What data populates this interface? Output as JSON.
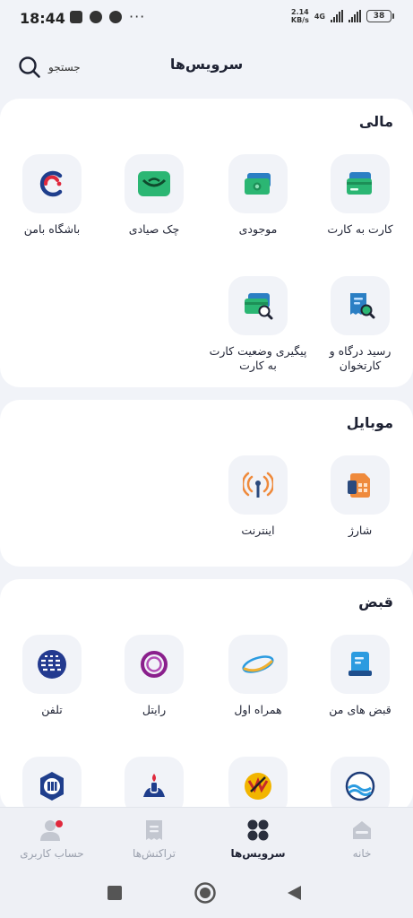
{
  "status_bar": {
    "time": "18:44",
    "speed_value": "2.14",
    "speed_unit": "KB/s",
    "network": "4G",
    "battery": "38"
  },
  "header": {
    "title": "سرویس‌ها",
    "search_label": "جستجو"
  },
  "sections": {
    "finance": {
      "title": "مالی",
      "items": [
        {
          "label": "کارت به کارت",
          "icon": "card-icon"
        },
        {
          "label": "موجودی",
          "icon": "balance-icon"
        },
        {
          "label": "چک صیادی",
          "icon": "cheque-icon"
        },
        {
          "label": "باشگاه بامن",
          "icon": "club-icon"
        },
        {
          "label": "رسید درگاه و کارتخوان",
          "icon": "receipt-search-icon"
        },
        {
          "label": "پیگیری وضعیت کارت به کارت",
          "icon": "card-track-icon"
        }
      ]
    },
    "mobile": {
      "title": "موبایل",
      "items": [
        {
          "label": "شارژ",
          "icon": "sim-card-icon"
        },
        {
          "label": "اینترنت",
          "icon": "antenna-icon"
        }
      ]
    },
    "bills": {
      "title": "قبض",
      "items": [
        {
          "label": "قبض های من",
          "icon": "bill-icon"
        },
        {
          "label": "همراه اول",
          "icon": "hamrah-aval-logo"
        },
        {
          "label": "رایتل",
          "icon": "rightel-logo"
        },
        {
          "label": "تلفن",
          "icon": "telecom-logo"
        },
        {
          "label": "",
          "icon": "water-logo"
        },
        {
          "label": "",
          "icon": "electricity-logo"
        },
        {
          "label": "",
          "icon": "gas-logo"
        },
        {
          "label": "",
          "icon": "municipality-logo"
        }
      ]
    }
  },
  "bottom_nav": [
    {
      "label": "خانه",
      "icon": "home-icon",
      "active": false
    },
    {
      "label": "سرویس‌ها",
      "icon": "services-grid-icon",
      "active": true
    },
    {
      "label": "تراکنش‌ها",
      "icon": "transactions-icon",
      "active": false
    },
    {
      "label": "حساب کاربری",
      "icon": "user-icon",
      "active": false
    }
  ],
  "colors": {
    "background": "#f1f3f8",
    "card": "#ffffff",
    "primary_text": "#1e2233",
    "green_accent": "#2bb673",
    "blue_accent": "#2b7fc4",
    "orange_accent": "#ef8a3c"
  }
}
